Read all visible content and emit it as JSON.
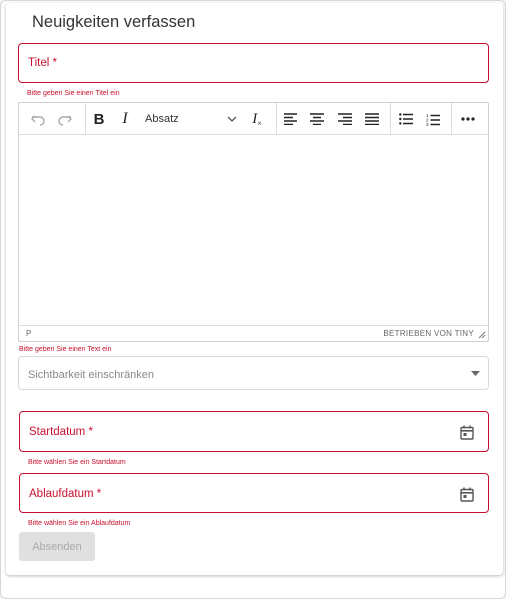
{
  "form": {
    "heading": "Neuigkeiten verfassen",
    "title_field": {
      "label": "Titel *",
      "error": "Bitte geben Sie einen Titel ein"
    },
    "editor": {
      "block_format": "Absatz",
      "path": "P",
      "branding": "BETRIEBEN VON TINY",
      "error": "Bitte geben Sie einen Text ein"
    },
    "visibility_select": {
      "placeholder": "Sichtbarkeit einschränken"
    },
    "start_date": {
      "label": "Startdatum *",
      "error": "Bitte wählen Sie ein Startdatum"
    },
    "end_date": {
      "label": "Ablaufdatum *",
      "error": "Bitte wählen Sie ein Ablaufdatum"
    },
    "submit_label": "Absenden"
  },
  "colors": {
    "error": "#c8102e",
    "disabled_button": "#e0e0e0"
  },
  "icons": [
    "undo-icon",
    "redo-icon",
    "bold-icon",
    "italic-icon",
    "chevron-down-icon",
    "clear-format-icon",
    "align-left-icon",
    "align-center-icon",
    "align-right-icon",
    "align-justify-icon",
    "bullet-list-icon",
    "numbered-list-icon",
    "more-icon",
    "caret-down-icon",
    "calendar-icon",
    "resize-handle-icon"
  ]
}
